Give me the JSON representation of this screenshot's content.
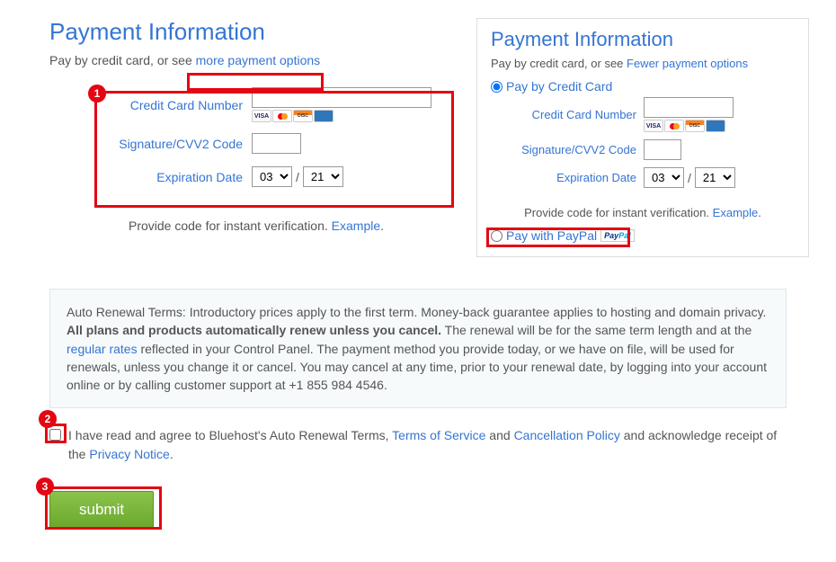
{
  "left": {
    "title": "Payment Information",
    "subtext_prefix": "Pay by credit card, or see ",
    "more_options": "more payment options",
    "cc_label": "Credit Card Number",
    "cvv_label": "Signature/CVV2 Code",
    "exp_label": "Expiration Date",
    "month": "03",
    "year": "21",
    "verify_prefix": "Provide code for instant verification. ",
    "example": "Example"
  },
  "right": {
    "title": "Payment Information",
    "subtext_prefix": "Pay by credit card, or see ",
    "fewer_options": "Fewer payment options",
    "pay_cc": "Pay by Credit Card",
    "cc_label": "Credit Card Number",
    "cvv_label": "Signature/CVV2 Code",
    "exp_label": "Expiration Date",
    "month": "03",
    "year": "21",
    "verify_prefix": "Provide code for instant verification. ",
    "example": "Example",
    "pay_paypal": "Pay with PayPal"
  },
  "terms": {
    "prefix": "Auto Renewal Terms: Introductory prices apply to the first term. Money-back guarantee applies to hosting and domain privacy. ",
    "bold": "All plans and products automatically renew unless you cancel.",
    "mid1": " The renewal will be for the same term length and at the ",
    "rates_link": "regular rates",
    "mid2": " reflected in your Control Panel. The payment method you provide today, or we have on file, will be used for renewals, unless you change it or cancel. You may cancel at any time, prior to your renewal date, by logging into your account online or by calling customer support at +1 855 984 4546."
  },
  "agree": {
    "t1": "I have read and agree to Bluehost's Auto Renewal Terms, ",
    "tos": "Terms of Service",
    "and1": " and ",
    "cancel": "Cancellation Policy",
    "t2": " and acknowledge receipt of the ",
    "privacy": "Privacy Notice",
    "dot": "."
  },
  "submit_label": "submit",
  "badges": {
    "b1": "1",
    "b2": "2",
    "b3": "3"
  }
}
